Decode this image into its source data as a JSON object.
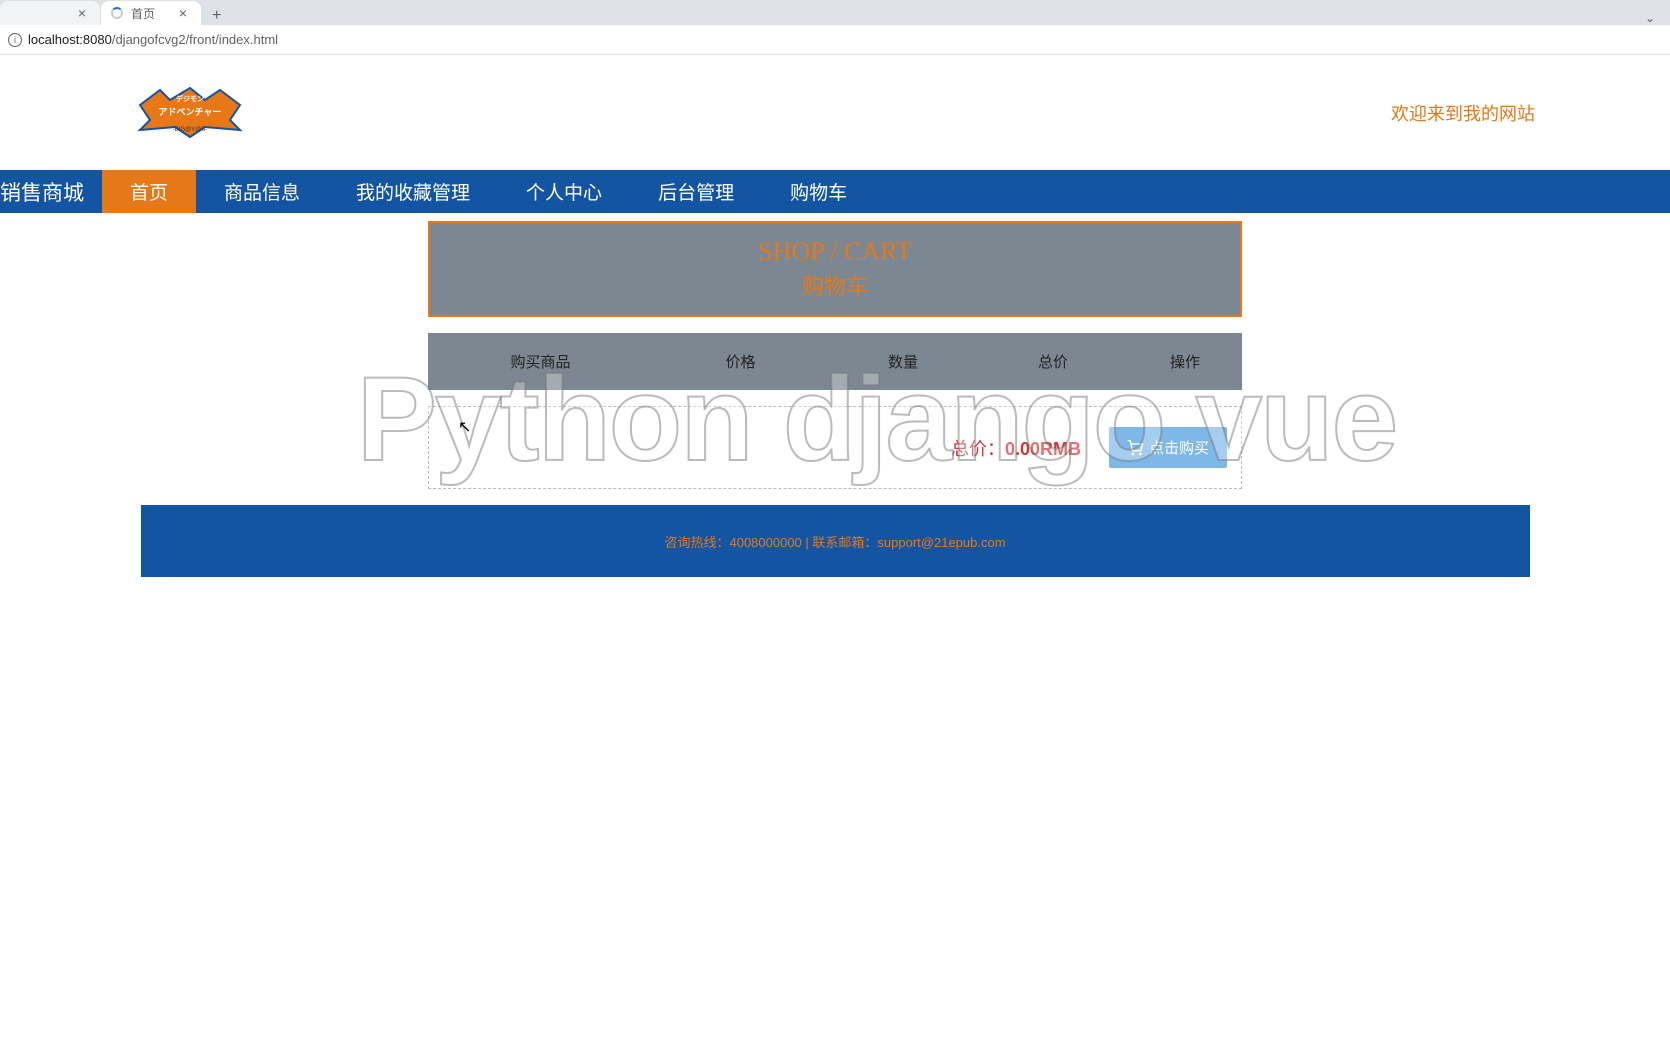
{
  "browser": {
    "tabs": [
      {
        "title": " ",
        "active": false
      },
      {
        "title": "首页",
        "active": true
      }
    ],
    "url_host": "localhost:8080",
    "url_path": "/djangofcvg2/front/index.html"
  },
  "header": {
    "logo_text_top": "デジモン",
    "logo_text_mid": "アドベンチャー",
    "logo_text_bottom": "-BIG@Y@S-",
    "welcome": "欢迎来到我的网站"
  },
  "nav": {
    "brand": "销售商城",
    "items": [
      "首页",
      "商品信息",
      "我的收藏管理",
      "个人中心",
      "后台管理",
      "购物车"
    ],
    "active_index": 0
  },
  "cart": {
    "title_en": "SHOP / CART",
    "title_cn": "购物车",
    "columns": {
      "product": "购买商品",
      "price": "价格",
      "quantity": "数量",
      "subtotal": "总价",
      "action": "操作"
    },
    "total_label": "总价：",
    "total_value": "0.00RMB",
    "checkout_label": "点击购买"
  },
  "footer": {
    "hotline_label": "咨询热线：",
    "hotline_value": "4008000000",
    "separator": " | ",
    "email_label": "联系邮箱：",
    "email_value": "support@21epub.com"
  },
  "watermark": "Python django vue"
}
